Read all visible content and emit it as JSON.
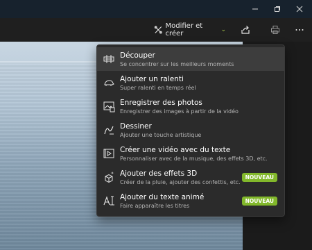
{
  "window": {
    "minimize_icon": "minimize-icon",
    "maximize_icon": "maximize-icon",
    "close_icon": "close-icon"
  },
  "toolbar": {
    "edit_create_label": "Modifier et créer",
    "edit_icon": "edit-create-icon",
    "share_icon": "share-icon",
    "print_icon": "print-icon",
    "more_icon": "more-icon"
  },
  "menu": {
    "items": [
      {
        "title": "Découper",
        "subtitle": "Se concentrer sur les meilleurs moments",
        "icon": "trim-icon",
        "badge": ""
      },
      {
        "title": "Ajouter un ralenti",
        "subtitle": "Super ralenti en temps réel",
        "icon": "slow-motion-icon",
        "badge": ""
      },
      {
        "title": "Enregistrer des photos",
        "subtitle": "Enregistrer des images à partir de la vidéo",
        "icon": "save-photos-icon",
        "badge": ""
      },
      {
        "title": "Dessiner",
        "subtitle": "Ajouter une touche artistique",
        "icon": "draw-icon",
        "badge": ""
      },
      {
        "title": "Créer une vidéo avec du texte",
        "subtitle": "Personnaliser avec de la musique, des effets 3D, etc.",
        "icon": "video-text-icon",
        "badge": ""
      },
      {
        "title": "Ajouter des effets 3D",
        "subtitle": "Créer de la pluie, ajouter des confettis, etc.",
        "icon": "3d-effects-icon",
        "badge": "NOUVEAU"
      },
      {
        "title": "Ajouter du texte animé",
        "subtitle": "Faire apparaître les titres",
        "icon": "animated-text-icon",
        "badge": "NOUVEAU"
      }
    ]
  },
  "colors": {
    "accent_green": "#82b82b",
    "menu_bg": "#2b2b2b",
    "active_item_bg": "#3d3d3d"
  }
}
